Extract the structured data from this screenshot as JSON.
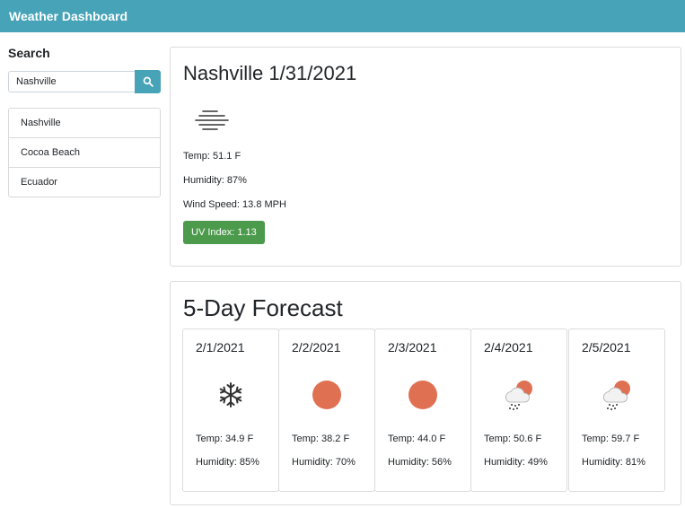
{
  "navbar": {
    "title": "Weather Dashboard"
  },
  "search": {
    "heading": "Search",
    "input_value": "Nashville",
    "button_icon": "search-icon",
    "history": [
      "Nashville",
      "Cocoa Beach",
      "Ecuador"
    ]
  },
  "current": {
    "title": "Nashville 1/31/2021",
    "icon": "fog-icon",
    "temp": "Temp: 51.1 F",
    "humidity": "Humidity: 87%",
    "wind": "Wind Speed: 13.8 MPH",
    "uv": "UV Index: 1.13",
    "uv_color": "#4c9a4c"
  },
  "forecast": {
    "heading": "5-Day Forecast",
    "days": [
      {
        "date": "2/1/2021",
        "icon": "snowflake-icon",
        "temp": "Temp: 34.9 F",
        "humidity": "Humidity: 85%"
      },
      {
        "date": "2/2/2021",
        "icon": "sun-icon",
        "temp": "Temp: 38.2 F",
        "humidity": "Humidity: 70%"
      },
      {
        "date": "2/3/2021",
        "icon": "sun-icon",
        "temp": "Temp: 44.0 F",
        "humidity": "Humidity: 56%"
      },
      {
        "date": "2/4/2021",
        "icon": "sun-cloud-rain-icon",
        "temp": "Temp: 50.6 F",
        "humidity": "Humidity: 49%"
      },
      {
        "date": "2/5/2021",
        "icon": "sun-cloud-rain-icon",
        "temp": "Temp: 59.7 F",
        "humidity": "Humidity: 81%"
      }
    ]
  },
  "colors": {
    "accent": "#47a3b7",
    "sun": "#e07052",
    "uv_low": "#4c9a4c"
  }
}
